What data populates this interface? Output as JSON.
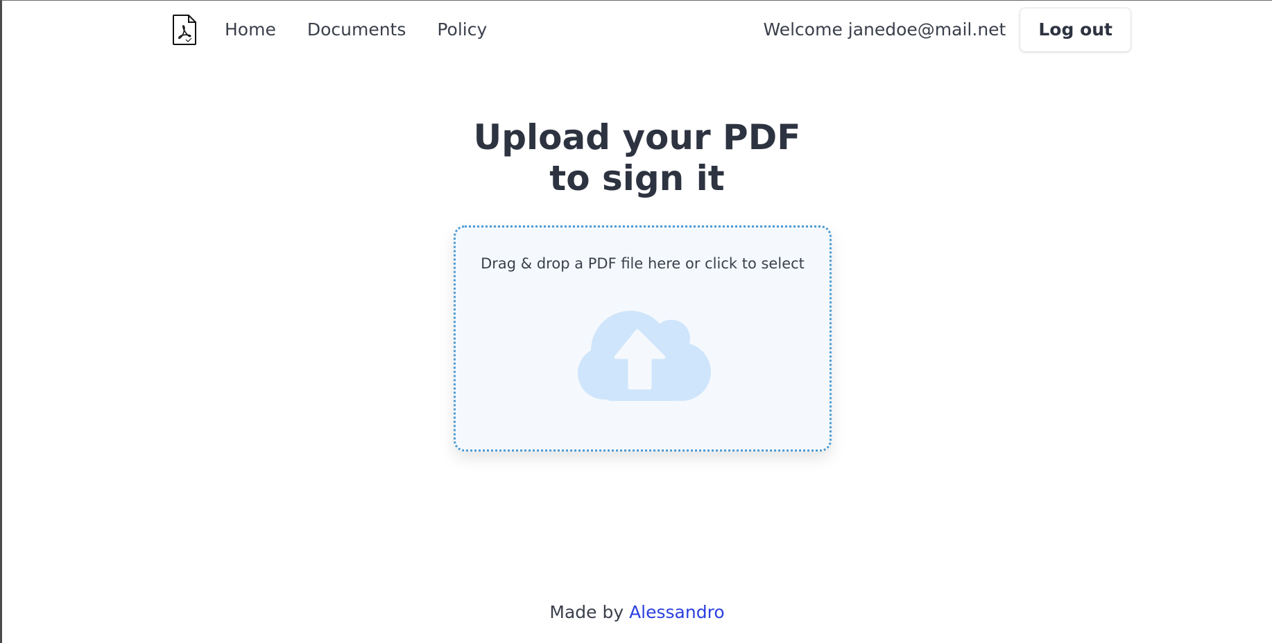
{
  "header": {
    "logo_icon": "pdf-file-icon",
    "nav": {
      "home": "Home",
      "documents": "Documents",
      "policy": "Policy"
    },
    "welcome_text": "Welcome janedoe@mail.net",
    "logout_label": "Log out"
  },
  "main": {
    "title": "Upload your PDF to sign it",
    "dropzone": {
      "text": "Drag & drop a PDF file here or click to select",
      "icon": "cloud-upload-icon",
      "icon_color": "#cfe5fb",
      "border_color": "#4a9ad3"
    }
  },
  "footer": {
    "prefix": "Made by ",
    "author": "Alessandro",
    "link_color": "#2b3fe0"
  }
}
